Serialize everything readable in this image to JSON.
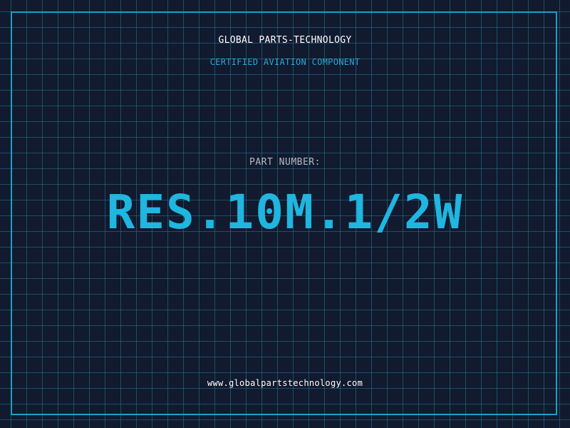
{
  "header": {
    "company": "GLOBAL PARTS-TECHNOLOGY",
    "tagline": "CERTIFIED AVIATION COMPONENT"
  },
  "main": {
    "label": "PART NUMBER:",
    "part_number": "RES.10M.1/2W"
  },
  "footer": {
    "website": "www.globalpartstechnology.com"
  },
  "colors": {
    "background": "#111a2e",
    "grid": "#287896",
    "accent": "#1fb6e0",
    "text": "#ffffff"
  }
}
